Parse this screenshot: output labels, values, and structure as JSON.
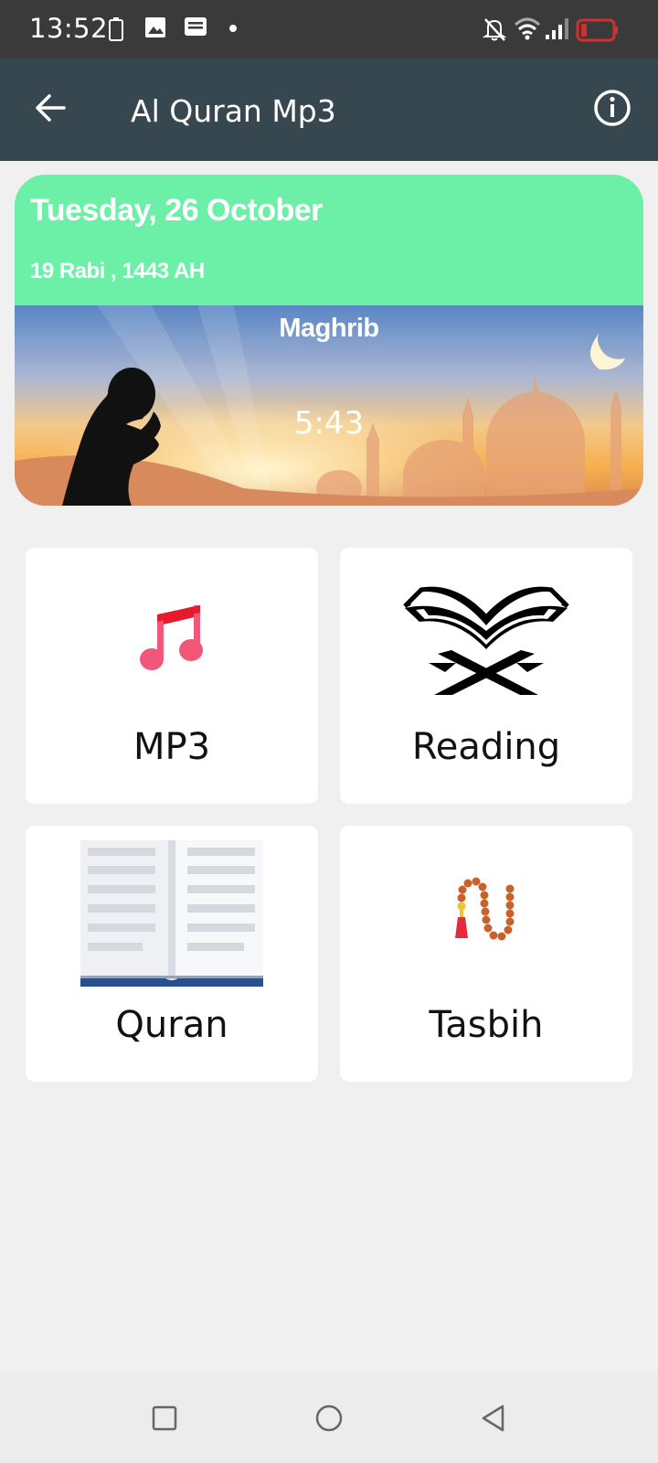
{
  "status_bar": {
    "time": "13:52",
    "icons": [
      "battery-saver-icon",
      "image-icon",
      "message-icon",
      "dot-icon",
      "notifications-off-icon",
      "wifi-icon",
      "signal-icon",
      "battery-low-icon"
    ]
  },
  "app_bar": {
    "title": "Al Quran Mp3",
    "back_icon": "arrow-back-icon",
    "info_icon": "info-icon"
  },
  "prayer_card": {
    "gregorian_date": "Tuesday, 26 October",
    "hijri_date": "19 Rabi , 1443 AH",
    "prayer_name": "Maghrib",
    "prayer_time": "5:43",
    "header_color": "#6cf0a8"
  },
  "menu": {
    "items": [
      {
        "label": "MP3",
        "icon": "music-note-icon"
      },
      {
        "label": "Reading",
        "icon": "quran-stand-icon"
      },
      {
        "label": "Quran",
        "icon": "open-book-icon"
      },
      {
        "label": "Tasbih",
        "icon": "prayer-beads-icon"
      }
    ]
  },
  "nav_bar": {
    "icons": [
      "recent-apps-icon",
      "home-icon",
      "back-icon"
    ]
  },
  "colors": {
    "app_bar": "#37474f",
    "status_bar": "#3a3a3a",
    "accent_green": "#6cf0a8",
    "background": "#f0f0f0"
  }
}
